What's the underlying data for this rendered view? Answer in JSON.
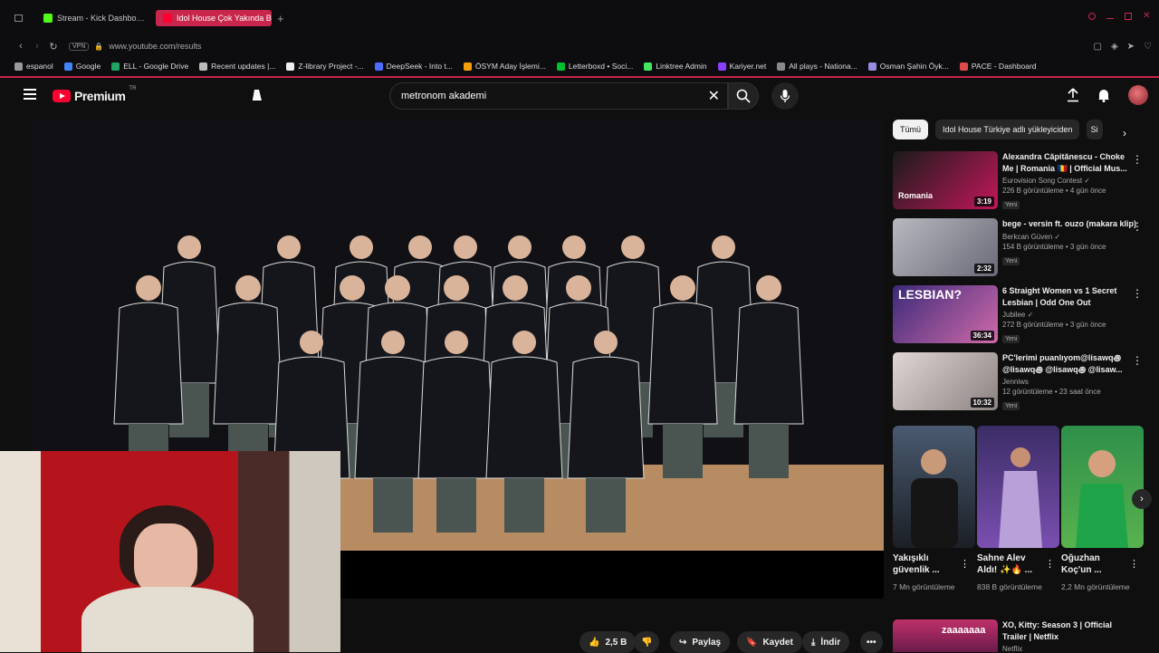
{
  "browser": {
    "tabs": [
      {
        "label": "Stream - Kick Dashbo…",
        "active": false,
        "color": "#53fc18"
      },
      {
        "label": "Idol House Çok Yakında B…",
        "active": true,
        "color": "#ff0033"
      }
    ],
    "new_tab": "+",
    "vpn": "VPN",
    "url": "www.youtube.com/results",
    "bookmarks": [
      {
        "label": "espanol",
        "color": "#999999"
      },
      {
        "label": "Google",
        "color": "#4285f4"
      },
      {
        "label": "ELL - Google Drive",
        "color": "#1fa463"
      },
      {
        "label": "Recent updates |...",
        "color": "#bbbbbb"
      },
      {
        "label": "Z-library Project -...",
        "color": "#eeeeee"
      },
      {
        "label": "DeepSeek - Into t...",
        "color": "#4d6bfe"
      },
      {
        "label": "ÖSYM Aday İşlemi...",
        "color": "#f59e0b"
      },
      {
        "label": "Letterboxd • Soci...",
        "color": "#00c030"
      },
      {
        "label": "Linktree Admin",
        "color": "#43e660"
      },
      {
        "label": "Kariyer.net",
        "color": "#8a3ffc"
      },
      {
        "label": "All plays - Nationa...",
        "color": "#888888"
      },
      {
        "label": "Osman Şahin Öyk...",
        "color": "#9b8ce0"
      },
      {
        "label": "PACE - Dashboard",
        "color": "#e04a4a"
      }
    ]
  },
  "youtube": {
    "logo_text": "Premium",
    "logo_sup": "TR",
    "search_value": "metronom akademi"
  },
  "player": {
    "likes": "2,5 B",
    "share": "Paylaş",
    "save": "Kaydet",
    "download": "İndir"
  },
  "chips": [
    "Tümü",
    "Idol House Türkiye adlı yükleyiciden",
    "Si"
  ],
  "recommendations": [
    {
      "title": "Alexandra Căpitănescu - Choke Me | Romania 🇷🇴 | Official Mus...",
      "channel": "Eurovision Song Contest ✓",
      "views": "226 B görüntüleme • 4 gün önce",
      "badge": "Yeni",
      "duration": "3:19",
      "thumb_label": "Romania"
    },
    {
      "title": "bege - versin ft. ouzo (makara klip)",
      "channel": "Berkcan Güven ✓",
      "views": "154 B görüntüleme • 3 gün önce",
      "badge": "Yeni",
      "duration": "2:32",
      "thumb_label": ""
    },
    {
      "title": "6 Straight Women vs 1 Secret Lesbian | Odd One Out",
      "channel": "Jubilee ✓",
      "views": "272 B görüntüleme • 3 gün önce",
      "badge": "Yeni",
      "duration": "36:34",
      "thumb_label": "LESBIAN?"
    },
    {
      "title": "PC'lerimi puanlıyom@lisawq꩜ @lisawq꩜ @lisawq꩜ @lisaw...",
      "channel": "Jenniws",
      "views": "12 görüntüleme • 23 saat önce",
      "badge": "Yeni",
      "duration": "10:32",
      "thumb_label": ""
    }
  ],
  "shorts": [
    {
      "title": "Yakışıklı güvenlik ...",
      "views": "7 Mn görüntüleme"
    },
    {
      "title": "Sahne Alev Aldı! ✨🔥 ...",
      "views": "838 B görüntüleme"
    },
    {
      "title": "Oğuzhan Koç'un ...",
      "views": "2,2 Mn görüntüleme"
    }
  ],
  "last_rec": {
    "title": "XO, Kitty: Season 3 | Official Trailer | Netflix",
    "channel": "Netflix",
    "thumb_text": "zaaaaaaa"
  }
}
